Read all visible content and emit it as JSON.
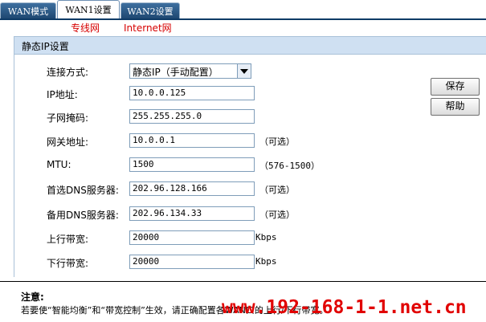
{
  "tabs": [
    {
      "label": "WAN模式",
      "active": false
    },
    {
      "label": "WAN1设置",
      "active": true
    },
    {
      "label": "WAN2设置",
      "active": false
    }
  ],
  "annotations": {
    "left": "专线网",
    "right": "Internet网"
  },
  "section_title": "静态IP设置",
  "connection": {
    "label": "连接方式:",
    "selected": "静态IP（手动配置）"
  },
  "fields": {
    "ip": {
      "label": "IP地址:",
      "value": "10.0.0.125"
    },
    "mask": {
      "label": "子网掩码:",
      "value": "255.255.255.0"
    },
    "gateway": {
      "label": "网关地址:",
      "value": "10.0.0.1",
      "hint": "（可选）"
    },
    "mtu": {
      "label": "MTU:",
      "value": "1500",
      "hint": "（576-1500）"
    },
    "dns1": {
      "label": "首选DNS服务器:",
      "value": "202.96.128.166",
      "hint": "（可选）"
    },
    "dns2": {
      "label": "备用DNS服务器:",
      "value": "202.96.134.33",
      "hint": "（可选）"
    },
    "upload": {
      "label": "上行带宽:",
      "value": "20000",
      "unit": "Kbps"
    },
    "download": {
      "label": "下行带宽:",
      "value": "20000",
      "unit": "Kbps"
    }
  },
  "buttons": {
    "save": "保存",
    "help": "帮助"
  },
  "note": {
    "title": "注意:",
    "text": "若要使“智能均衡”和“带宽控制”生效，请正确配置各WAN口的上行/下行带宽。"
  },
  "watermark": "www.192-168-1-1.net.cn",
  "colors": {
    "tab_dark": "#1d466f",
    "header_bg": "#cfe0f2",
    "accent_red": "#d60000"
  }
}
